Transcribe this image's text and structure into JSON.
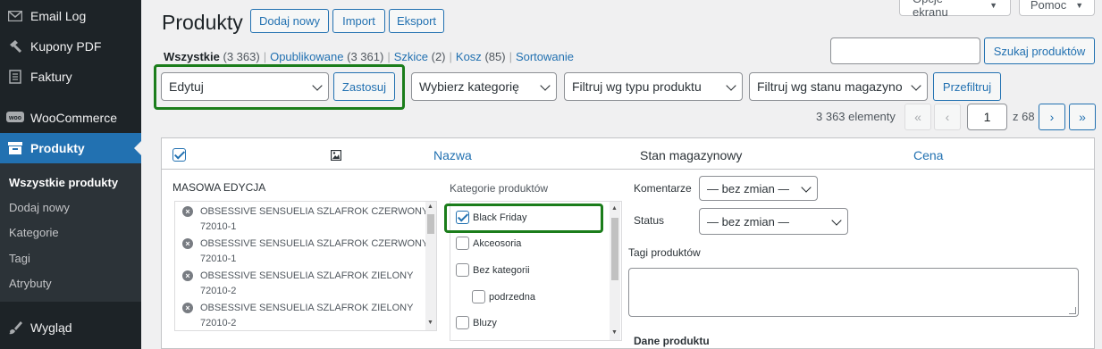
{
  "sidebar": {
    "items": [
      {
        "label": "Email Log",
        "icon": "envelope-icon"
      },
      {
        "label": "Kupony PDF",
        "icon": "hammer-icon"
      },
      {
        "label": "Faktury",
        "icon": "document-icon"
      },
      {
        "label": "WooCommerce",
        "icon": "woo-icon"
      },
      {
        "label": "Produkty",
        "icon": "archive-icon",
        "active": true
      },
      {
        "label": "Wygląd",
        "icon": "brush-icon"
      }
    ],
    "submenu": [
      "Wszystkie produkty",
      "Dodaj nowy",
      "Kategorie",
      "Tagi",
      "Atrybuty"
    ]
  },
  "header": {
    "title": "Produkty",
    "buttons": [
      "Dodaj nowy",
      "Import",
      "Eksport"
    ],
    "screen_options": "Opcje ekranu",
    "help": "Pomoc"
  },
  "views": {
    "all": "Wszystkie",
    "all_count": "(3 363)",
    "published": "Opublikowane",
    "published_count": "(3 361)",
    "drafts": "Szkice",
    "drafts_count": "(2)",
    "trash": "Kosz",
    "trash_count": "(85)",
    "sorting": "Sortowanie"
  },
  "search": {
    "button": "Szukaj produktów",
    "value": ""
  },
  "filters": {
    "bulk_action": "Edytuj",
    "apply": "Zastosuj",
    "category": "Wybierz kategorię",
    "product_type": "Filtruj wg typu produktu",
    "stock_status": "Filtruj wg stanu magazynowego",
    "filter_button": "Przefiltruj"
  },
  "pagination": {
    "count": "3 363 elementy",
    "first": "«",
    "prev": "‹",
    "current": "1",
    "of": "z 68",
    "next": "›",
    "last": "»"
  },
  "table": {
    "columns": {
      "image_icon": "image-icon",
      "name": "Nazwa",
      "stock": "Stan magazynowy",
      "price": "Cena"
    }
  },
  "bulk_edit": {
    "title": "MASOWA EDYCJA",
    "items": [
      {
        "line1": "OBSESSIVE SENSUELIA SZLAFROK CZERWONY",
        "line2": "72010-1"
      },
      {
        "line1": "OBSESSIVE SENSUELIA SZLAFROK CZERWONY",
        "line2": "72010-1"
      },
      {
        "line1": "OBSESSIVE SENSUELIA SZLAFROK ZIELONY",
        "line2": "72010-2"
      },
      {
        "line1": "OBSESSIVE SENSUELIA SZLAFROK ZIELONY",
        "line2": "72010-2"
      }
    ],
    "categories_title": "Kategorie produktów",
    "categories": [
      {
        "label": "Black Friday",
        "checked": true
      },
      {
        "label": "Akceosoria",
        "checked": false
      },
      {
        "label": "Bez kategorii",
        "checked": false
      },
      {
        "label": "podrzedna",
        "checked": false,
        "child": true
      },
      {
        "label": "Bluzy",
        "checked": false
      }
    ],
    "comments_label": "Komentarze",
    "comments_value": "— bez zmian —",
    "status_label": "Status",
    "status_value": "— bez zmian —",
    "tags_label": "Tagi produktów",
    "product_data_label": "Dane produktu"
  },
  "colors": {
    "accent": "#2271b1",
    "sidebar": "#1d2327",
    "highlight": "#1b7d1b"
  }
}
